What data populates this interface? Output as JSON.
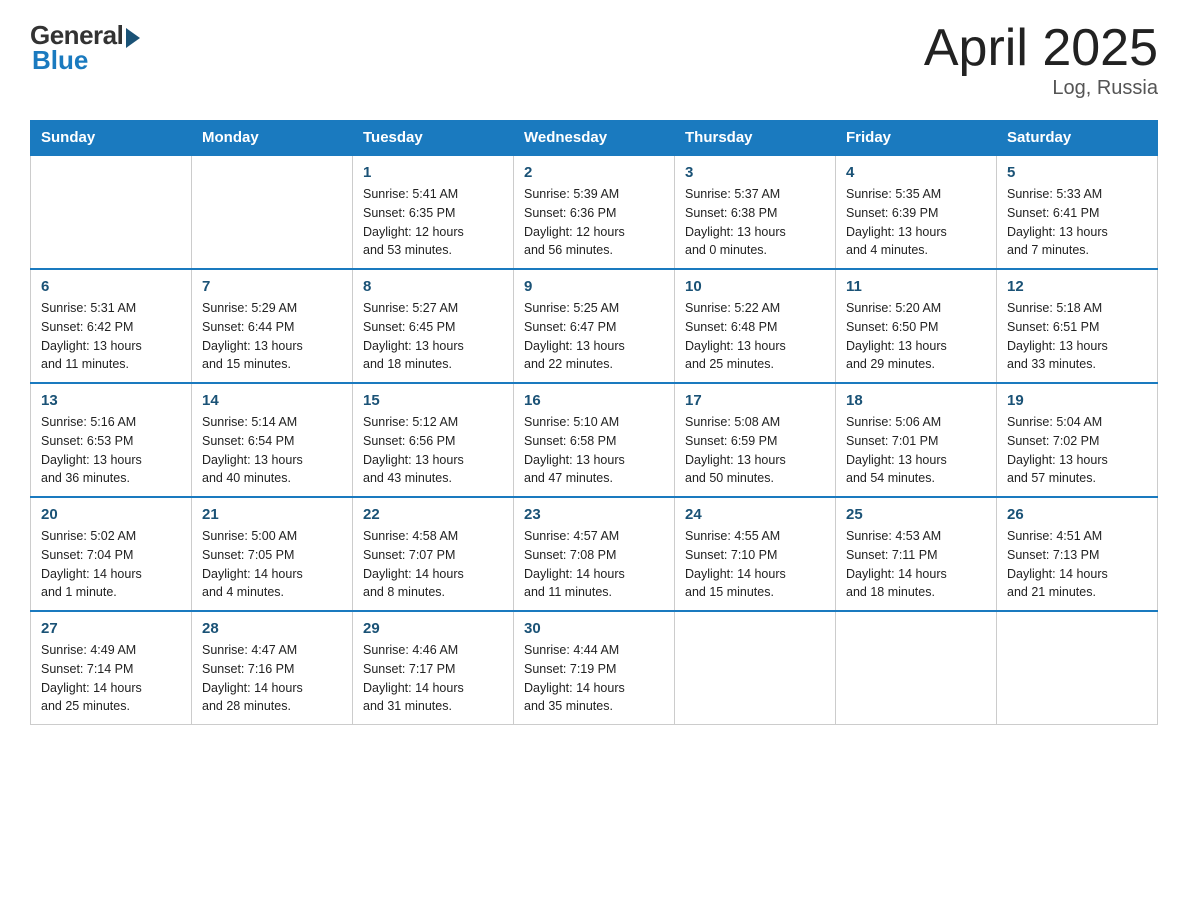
{
  "header": {
    "logo_general": "General",
    "logo_blue": "Blue",
    "logo_subtitle": "Blue",
    "title": "April 2025",
    "location": "Log, Russia"
  },
  "weekdays": [
    "Sunday",
    "Monday",
    "Tuesday",
    "Wednesday",
    "Thursday",
    "Friday",
    "Saturday"
  ],
  "weeks": [
    [
      {
        "day": "",
        "info": ""
      },
      {
        "day": "",
        "info": ""
      },
      {
        "day": "1",
        "info": "Sunrise: 5:41 AM\nSunset: 6:35 PM\nDaylight: 12 hours\nand 53 minutes."
      },
      {
        "day": "2",
        "info": "Sunrise: 5:39 AM\nSunset: 6:36 PM\nDaylight: 12 hours\nand 56 minutes."
      },
      {
        "day": "3",
        "info": "Sunrise: 5:37 AM\nSunset: 6:38 PM\nDaylight: 13 hours\nand 0 minutes."
      },
      {
        "day": "4",
        "info": "Sunrise: 5:35 AM\nSunset: 6:39 PM\nDaylight: 13 hours\nand 4 minutes."
      },
      {
        "day": "5",
        "info": "Sunrise: 5:33 AM\nSunset: 6:41 PM\nDaylight: 13 hours\nand 7 minutes."
      }
    ],
    [
      {
        "day": "6",
        "info": "Sunrise: 5:31 AM\nSunset: 6:42 PM\nDaylight: 13 hours\nand 11 minutes."
      },
      {
        "day": "7",
        "info": "Sunrise: 5:29 AM\nSunset: 6:44 PM\nDaylight: 13 hours\nand 15 minutes."
      },
      {
        "day": "8",
        "info": "Sunrise: 5:27 AM\nSunset: 6:45 PM\nDaylight: 13 hours\nand 18 minutes."
      },
      {
        "day": "9",
        "info": "Sunrise: 5:25 AM\nSunset: 6:47 PM\nDaylight: 13 hours\nand 22 minutes."
      },
      {
        "day": "10",
        "info": "Sunrise: 5:22 AM\nSunset: 6:48 PM\nDaylight: 13 hours\nand 25 minutes."
      },
      {
        "day": "11",
        "info": "Sunrise: 5:20 AM\nSunset: 6:50 PM\nDaylight: 13 hours\nand 29 minutes."
      },
      {
        "day": "12",
        "info": "Sunrise: 5:18 AM\nSunset: 6:51 PM\nDaylight: 13 hours\nand 33 minutes."
      }
    ],
    [
      {
        "day": "13",
        "info": "Sunrise: 5:16 AM\nSunset: 6:53 PM\nDaylight: 13 hours\nand 36 minutes."
      },
      {
        "day": "14",
        "info": "Sunrise: 5:14 AM\nSunset: 6:54 PM\nDaylight: 13 hours\nand 40 minutes."
      },
      {
        "day": "15",
        "info": "Sunrise: 5:12 AM\nSunset: 6:56 PM\nDaylight: 13 hours\nand 43 minutes."
      },
      {
        "day": "16",
        "info": "Sunrise: 5:10 AM\nSunset: 6:58 PM\nDaylight: 13 hours\nand 47 minutes."
      },
      {
        "day": "17",
        "info": "Sunrise: 5:08 AM\nSunset: 6:59 PM\nDaylight: 13 hours\nand 50 minutes."
      },
      {
        "day": "18",
        "info": "Sunrise: 5:06 AM\nSunset: 7:01 PM\nDaylight: 13 hours\nand 54 minutes."
      },
      {
        "day": "19",
        "info": "Sunrise: 5:04 AM\nSunset: 7:02 PM\nDaylight: 13 hours\nand 57 minutes."
      }
    ],
    [
      {
        "day": "20",
        "info": "Sunrise: 5:02 AM\nSunset: 7:04 PM\nDaylight: 14 hours\nand 1 minute."
      },
      {
        "day": "21",
        "info": "Sunrise: 5:00 AM\nSunset: 7:05 PM\nDaylight: 14 hours\nand 4 minutes."
      },
      {
        "day": "22",
        "info": "Sunrise: 4:58 AM\nSunset: 7:07 PM\nDaylight: 14 hours\nand 8 minutes."
      },
      {
        "day": "23",
        "info": "Sunrise: 4:57 AM\nSunset: 7:08 PM\nDaylight: 14 hours\nand 11 minutes."
      },
      {
        "day": "24",
        "info": "Sunrise: 4:55 AM\nSunset: 7:10 PM\nDaylight: 14 hours\nand 15 minutes."
      },
      {
        "day": "25",
        "info": "Sunrise: 4:53 AM\nSunset: 7:11 PM\nDaylight: 14 hours\nand 18 minutes."
      },
      {
        "day": "26",
        "info": "Sunrise: 4:51 AM\nSunset: 7:13 PM\nDaylight: 14 hours\nand 21 minutes."
      }
    ],
    [
      {
        "day": "27",
        "info": "Sunrise: 4:49 AM\nSunset: 7:14 PM\nDaylight: 14 hours\nand 25 minutes."
      },
      {
        "day": "28",
        "info": "Sunrise: 4:47 AM\nSunset: 7:16 PM\nDaylight: 14 hours\nand 28 minutes."
      },
      {
        "day": "29",
        "info": "Sunrise: 4:46 AM\nSunset: 7:17 PM\nDaylight: 14 hours\nand 31 minutes."
      },
      {
        "day": "30",
        "info": "Sunrise: 4:44 AM\nSunset: 7:19 PM\nDaylight: 14 hours\nand 35 minutes."
      },
      {
        "day": "",
        "info": ""
      },
      {
        "day": "",
        "info": ""
      },
      {
        "day": "",
        "info": ""
      }
    ]
  ]
}
